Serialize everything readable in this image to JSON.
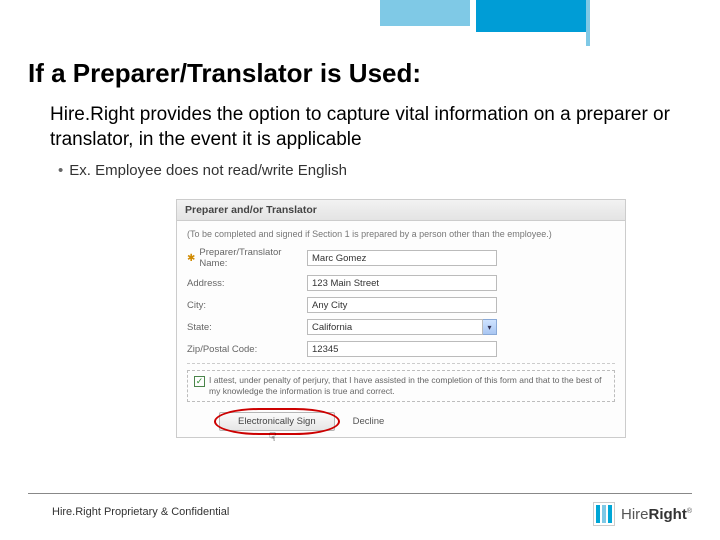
{
  "title": "If a Preparer/Translator is Used:",
  "lead": "Hire.Right provides the option to capture vital information on a preparer or translator, in the event it is applicable",
  "bullet": "Ex. Employee does not read/write English",
  "panel": {
    "header": "Preparer and/or Translator",
    "note": "(To be completed and signed if Section 1 is prepared by a person other than the employee.)",
    "fields": {
      "name_label": "Preparer/Translator Name:",
      "name_value": "Marc Gomez",
      "address_label": "Address:",
      "address_value": "123 Main Street",
      "city_label": "City:",
      "city_value": "Any City",
      "state_label": "State:",
      "state_value": "California",
      "zip_label": "Zip/Postal Code:",
      "zip_value": "12345"
    },
    "attest": "I attest, under penalty of perjury, that I have assisted in the completion of this form and that to the best of my knowledge the information is true and correct.",
    "sign_btn": "Electronically Sign",
    "decline_btn": "Decline"
  },
  "footer": "Hire.Right Proprietary & Confidential",
  "brand": {
    "left": "Hire",
    "right": "Right"
  }
}
